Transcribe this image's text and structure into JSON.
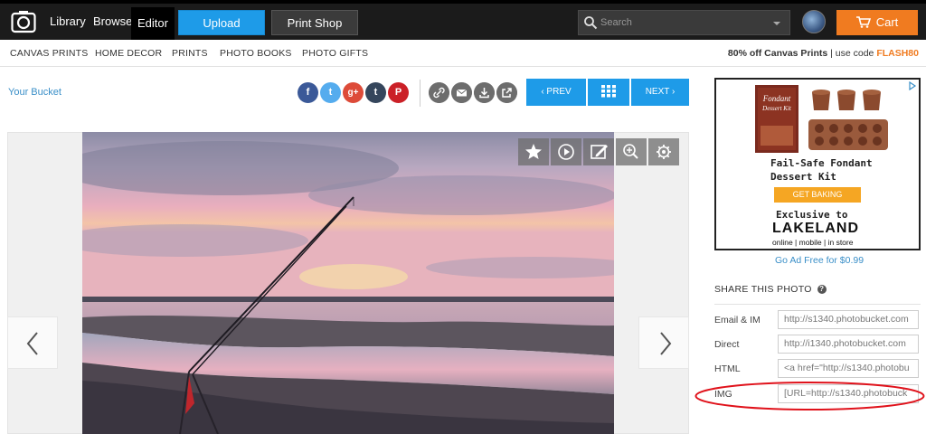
{
  "topnav": {
    "library": "Library",
    "browse": "Browse",
    "editor": "Editor",
    "upload": "Upload",
    "print_shop": "Print Shop",
    "search_placeholder": "Search",
    "cart": "Cart"
  },
  "subnav": {
    "items": [
      "CANVAS PRINTS",
      "HOME DECOR",
      "PRINTS",
      "PHOTO BOOKS",
      "PHOTO GIFTS"
    ],
    "promo_bold": "80% off Canvas Prints",
    "promo_mid": " | use code ",
    "promo_code": "FLASH80"
  },
  "toolbar": {
    "bucket": "Your Bucket",
    "share_icons": [
      {
        "label": "f",
        "color": "#3b5998",
        "icon": "facebook-icon"
      },
      {
        "label": "t",
        "color": "#55acee",
        "icon": "twitter-icon"
      },
      {
        "label": "g+",
        "color": "#dd4b39",
        "icon": "google-plus-icon"
      },
      {
        "label": "t",
        "color": "#35465c",
        "icon": "tumblr-icon"
      },
      {
        "label": "P",
        "color": "#cb2027",
        "icon": "pinterest-icon"
      }
    ],
    "prev": "‹ PREV",
    "next": "NEXT ›"
  },
  "sidebar": {
    "ad": {
      "title_line1": "Fail-Safe Fondant",
      "title_line2": "Dessert Kit",
      "button": "GET BAKING",
      "exclusive": "Exclusive to",
      "brand": "LAKELAND",
      "sub": "online | mobile | in store",
      "box_label": "Fondant Dessert Kit"
    },
    "ad_free": "Go Ad Free for $0.99",
    "share_heading": "SHARE THIS PHOTO",
    "fields": [
      {
        "label": "Email & IM",
        "value": "http://s1340.photobucket.com"
      },
      {
        "label": "Direct",
        "value": "http://i1340.photobucket.com"
      },
      {
        "label": "HTML",
        "value": "<a href=\"http://s1340.photobu"
      },
      {
        "label": "IMG",
        "value": "[URL=http://s1340.photobuck"
      }
    ]
  },
  "colors": {
    "accent_blue": "#1e9be8",
    "cart_orange": "#f07b20",
    "annotation_red": "#e0121b"
  }
}
